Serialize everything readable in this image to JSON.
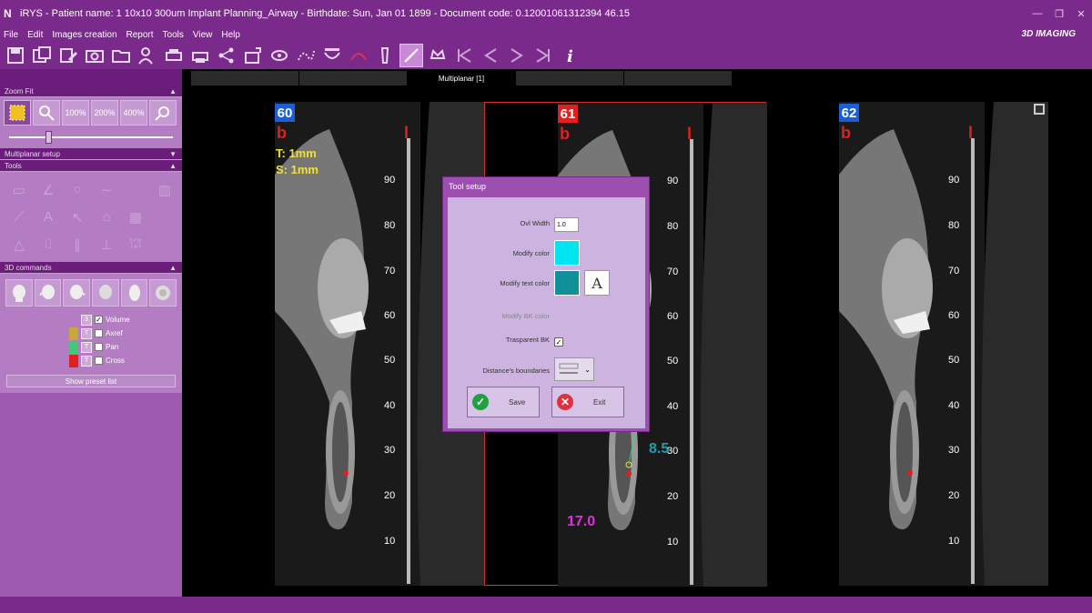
{
  "window": {
    "title": "iRYS - Patient name: 1 10x10 300um Implant Planning_Airway - Birthdate: Sun, Jan 01 1899 - Document code: 0.12001061312394 46.15",
    "brand": "3D IMAGING"
  },
  "menu": [
    "File",
    "Edit",
    "Images creation",
    "Report",
    "Tools",
    "View",
    "Help"
  ],
  "toolbar": {
    "icons": [
      "save-icon",
      "save-as-icon",
      "edit-icon",
      "camera-icon",
      "folder-icon",
      "patient-icon",
      "print-preview-icon",
      "print-icon",
      "share-icon",
      "export-icon",
      "eye-icon",
      "nerve-icon",
      "panoramic-icon",
      "curve-icon",
      "implant-icon",
      "measure-tool-icon",
      "crown-icon",
      "first-icon",
      "prev-icon",
      "next-icon",
      "last-icon",
      "info-icon"
    ]
  },
  "left_panel": {
    "zoom_head": "Zoom Fit",
    "zoom_buttons": [
      "100%",
      "200%",
      "400%"
    ],
    "multiplanar_head": "Multiplanar setup",
    "tools_head": "Tools",
    "cmd_head": "3D commands",
    "volumes": [
      {
        "name": "Volume",
        "color": "",
        "visible": true,
        "t": "3"
      },
      {
        "name": "Axref",
        "color": "#c8a83a",
        "visible": false,
        "t": "T"
      },
      {
        "name": "Pan",
        "color": "#42c878",
        "visible": false,
        "t": "T"
      },
      {
        "name": "Cross",
        "color": "#e02020",
        "visible": false,
        "t": "T"
      }
    ],
    "preset_button": "Show preset list"
  },
  "viewer": {
    "tabs": [
      "",
      "",
      "Multiplanar [1]",
      "",
      ""
    ],
    "slices": [
      {
        "num": "60",
        "num_color": "#1c5ed6",
        "b": "b",
        "l": "l"
      },
      {
        "num": "61",
        "num_color": "#e02020",
        "b": "b",
        "l": "l"
      },
      {
        "num": "62",
        "num_color": "#1c5ed6",
        "b": "b",
        "l": "l"
      }
    ],
    "thickness": "T: 1mm",
    "spacing": "S: 1mm",
    "scale_labels": [
      "90",
      "80",
      "70",
      "60",
      "50",
      "40",
      "30",
      "20",
      "10"
    ],
    "measure_height": "17.0",
    "measure_width": "8.5"
  },
  "dialog": {
    "title": "Tool setup",
    "ovl_width_label": "Ovl Width",
    "ovl_width_value": "1.0",
    "modify_color_label": "Modify color",
    "modify_color": "#00e5f0",
    "modify_text_color_label": "Modify text color",
    "modify_text_color": "#12909a",
    "font_button": "A",
    "modify_bk_label": "Modify BK color",
    "transparent_label": "Trasparent BK",
    "transparent_checked": "✓",
    "distance_label": "Distance's boundaries",
    "save_label": "Save",
    "exit_label": "Exit"
  }
}
